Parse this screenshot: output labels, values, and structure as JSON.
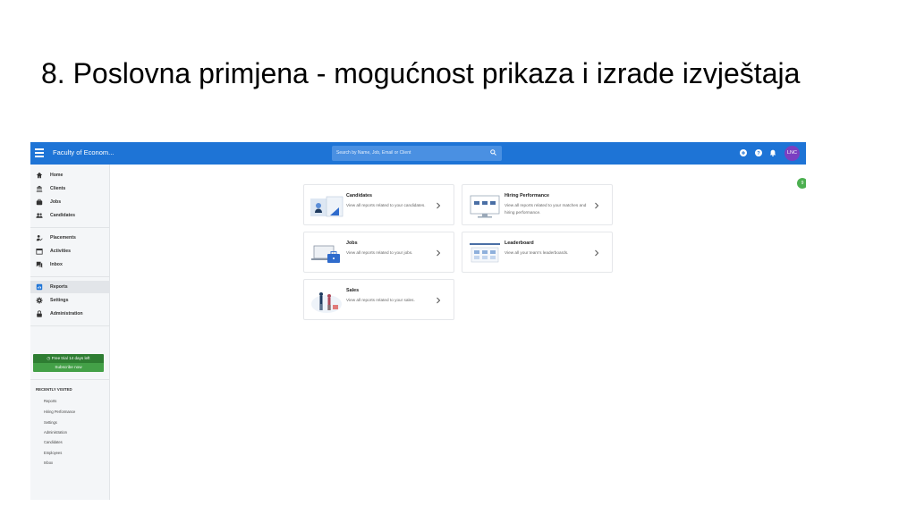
{
  "slide": {
    "title": "8. Poslovna primjena - mogućnost prikaza i izrade izvještaja"
  },
  "topbar": {
    "org_name": "Faculty of Econom...",
    "search_placeholder": "Search by Name, Job, Email or Client",
    "avatar_initials": "LNC",
    "icons": [
      "menu-icon",
      "search-icon",
      "add-icon",
      "help-icon",
      "bell-icon"
    ],
    "colors": {
      "bar": "#1e74d6",
      "avatar": "#7b3fc1"
    }
  },
  "sidebar": {
    "groups": [
      [
        {
          "label": "Home",
          "icon": "home-icon"
        },
        {
          "label": "Clients",
          "icon": "building-icon"
        },
        {
          "label": "Jobs",
          "icon": "briefcase-icon"
        },
        {
          "label": "Candidates",
          "icon": "people-icon"
        }
      ],
      [
        {
          "label": "Placements",
          "icon": "person-check-icon"
        },
        {
          "label": "Activities",
          "icon": "calendar-icon"
        },
        {
          "label": "Inbox",
          "icon": "chat-icon"
        }
      ],
      [
        {
          "label": "Reports",
          "icon": "reports-icon",
          "active": true
        },
        {
          "label": "Settings",
          "icon": "gear-icon"
        },
        {
          "label": "Administration",
          "icon": "lock-icon"
        }
      ]
    ],
    "trial_text": "Free trial 14 days left",
    "subscribe_label": "Subscribe now",
    "recently_visited_title": "RECENTLY VISITED",
    "recently_visited": [
      "Reports",
      "Hiring Performance",
      "Settings",
      "Administration",
      "Candidates",
      "Employees",
      "Inbox"
    ],
    "colors": {
      "trial": "#2e7d32",
      "subscribe": "#43a047"
    }
  },
  "reports": {
    "cards": [
      {
        "title": "Candidates",
        "description": "View all reports related to your candidates."
      },
      {
        "title": "Hiring Performance",
        "description": "View all reports related to your matches and hiring performance."
      },
      {
        "title": "Jobs",
        "description": "View all reports related to your jobs."
      },
      {
        "title": "Leaderboard",
        "description": "View all your team's leaderboards."
      },
      {
        "title": "Sales",
        "description": "View all reports related to your sales."
      }
    ]
  },
  "badge": {
    "text": "9",
    "color": "#4caf50"
  }
}
